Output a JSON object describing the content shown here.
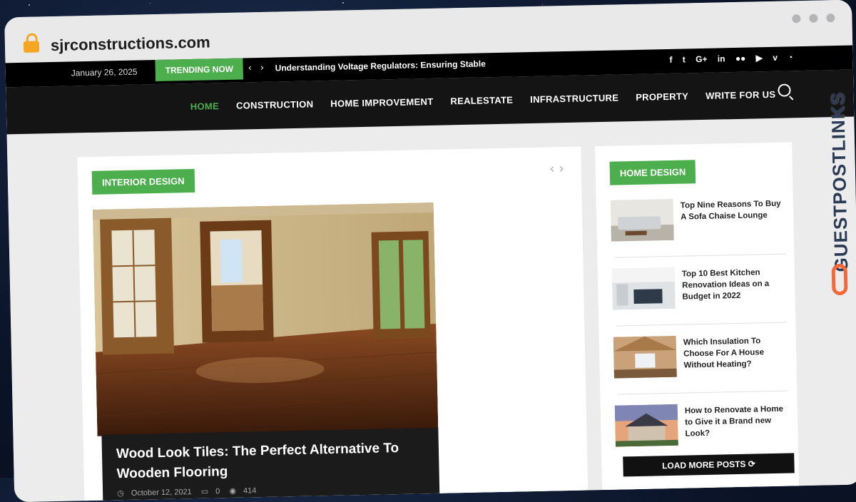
{
  "browser": {
    "url": "sjrconstructions.com"
  },
  "topbar": {
    "date": "January 26, 2025",
    "trending_label": "TRENDING NOW",
    "ticker_text": "Understanding Voltage Regulators: Ensuring Stable Po",
    "social_icons": [
      "facebook-icon",
      "twitter-icon",
      "google-plus-icon",
      "linkedin-icon",
      "flickr-icon",
      "youtube-icon",
      "vimeo-icon",
      "rss-icon"
    ]
  },
  "nav": {
    "items": [
      "HOME",
      "CONSTRUCTION",
      "HOME IMPROVEMENT",
      "REALESTATE",
      "INFRASTRUCTURE",
      "PROPERTY",
      "WRITE FOR US"
    ],
    "active_index": 0
  },
  "featured": {
    "category": "INTERIOR DESIGN",
    "title": "Wood Look Tiles: The Perfect Alternative To Wooden Flooring",
    "date": "October 12, 2021",
    "comments": "0",
    "views": "414"
  },
  "sidebar": {
    "category": "HOME DESIGN",
    "posts": [
      {
        "title": "Top Nine Reasons To Buy A Sofa Chaise Lounge"
      },
      {
        "title": "Top 10 Best Kitchen Renovation Ideas on a Budget in 2022"
      },
      {
        "title": "Which Insulation To Choose For A House Without Heating?"
      },
      {
        "title": "How to Renovate a Home to Give it a Brand new Look?"
      }
    ],
    "load_more": "LOAD MORE POSTS"
  },
  "watermark": {
    "text": "GUESTPOSTLINKS"
  },
  "colors": {
    "accent": "#4cae4c",
    "topbar": "#000000",
    "nav": "#141414",
    "watermark_logo": "#f26a3a"
  }
}
